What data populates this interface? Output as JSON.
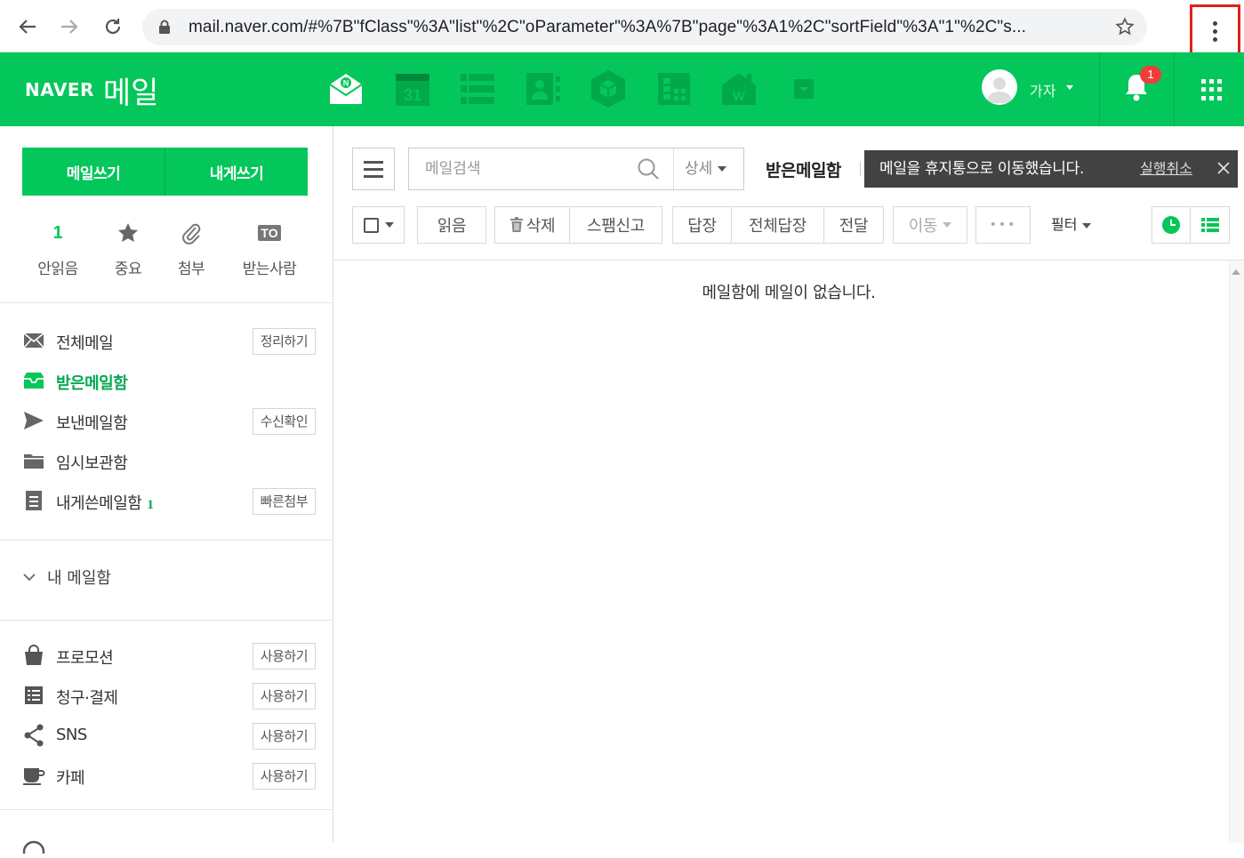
{
  "browser": {
    "url": "mail.naver.com/#%7B\"fClass\"%3A\"list\"%2C\"oParameter\"%3A%7B\"page\"%3A1%2C\"sortField\"%3A\"1\"%2C\"s...",
    "back_icon": "arrow-left-icon",
    "forward_icon": "arrow-right-icon",
    "reload_icon": "reload-icon",
    "bookmark_icon": "star-icon",
    "menu_icon": "vertical-dots-icon",
    "menu_highlight_color": "#e0201d"
  },
  "header": {
    "logo_brand": "NAVER",
    "logo_service": "메일",
    "brand_color": "#03c75a",
    "calendar_day": "31",
    "user_name": "가자",
    "notification_count": "1"
  },
  "sidebar": {
    "compose_label": "메일쓰기",
    "self_compose_label": "내게쓰기",
    "quick": [
      {
        "count": "1",
        "label": "안읽음"
      },
      {
        "icon": "star-icon",
        "label": "중요"
      },
      {
        "icon": "paperclip-icon",
        "label": "첨부"
      },
      {
        "icon_text": "TO",
        "label": "받는사람"
      }
    ],
    "folders": [
      {
        "name": "전체메일",
        "button": "정리하기",
        "icon": "envelope-icon"
      },
      {
        "name": "받은메일함",
        "active": true,
        "icon": "inbox-icon"
      },
      {
        "name": "보낸메일함",
        "button": "수신확인",
        "icon": "send-icon"
      },
      {
        "name": "임시보관함",
        "icon": "folder-icon"
      },
      {
        "name": "내게쓴메일함",
        "count": "1",
        "button": "빠른첨부",
        "icon": "note-icon"
      }
    ],
    "my_mailbox_label": "내 메일함",
    "extras": [
      {
        "name": "프로모션",
        "button": "사용하기",
        "icon": "shopping-bag-icon"
      },
      {
        "name": "청구·결제",
        "button": "사용하기",
        "icon": "receipt-icon"
      },
      {
        "name": "SNS",
        "button": "사용하기",
        "icon": "share-icon"
      },
      {
        "name": "카페",
        "button": "사용하기",
        "icon": "coffee-cup-icon"
      }
    ]
  },
  "main": {
    "search_placeholder": "메일검색",
    "search_detail_label": "상세",
    "mailbox_title": "받은메일함",
    "toast_message": "메일을 휴지통으로 이동했습니다.",
    "toast_undo": "실행취소",
    "toolbar": {
      "read": "읽음",
      "delete": "삭제",
      "spam": "스팸신고",
      "reply": "답장",
      "reply_all": "전체답장",
      "forward": "전달",
      "move": "이동",
      "more": "•••",
      "filter": "필터"
    },
    "empty_message": "메일함에 메일이 없습니다."
  }
}
